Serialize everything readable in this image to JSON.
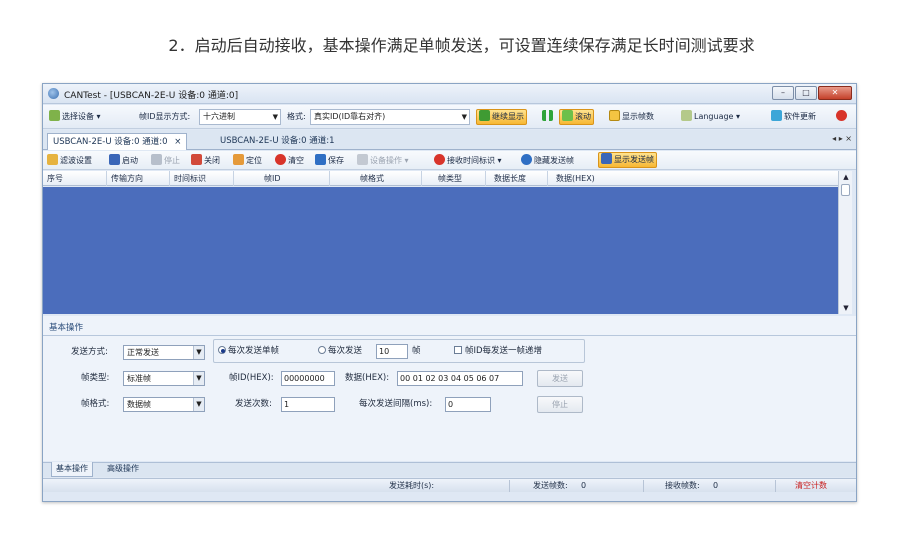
{
  "caption": "2．启动后自动接收，基本操作满足单帧发送，可设置连续保存满足长时间测试要求",
  "window": {
    "title": "CANTest - [USBCAN-2E-U 设备:0 通道:0]",
    "controls": {
      "minimize": "–",
      "maximize": "□",
      "close": "✕"
    }
  },
  "toolbar1": {
    "select_device": "选择设备",
    "frame_id_display_label": "帧ID显示方式:",
    "frame_id_display_value": "十六进制",
    "format_label": "格式:",
    "format_value": "真实ID(ID靠右对齐)",
    "continuous_display": "继续显示",
    "pause_icon_label": "",
    "scroll": "滚动",
    "show_frame_count": "显示帧数",
    "language": "Language",
    "software_update": "软件更新"
  },
  "tabs": [
    {
      "label": "USBCAN-2E-U 设备:0 通道:0",
      "close": "×"
    },
    {
      "label": "USBCAN-2E-U 设备:0 通道:1"
    }
  ],
  "tab_arrows": "◂ ▸ ×",
  "toolbar2": {
    "filter_settings": "滤波设置",
    "start": "启动",
    "stop": "停止",
    "close": "关闭",
    "locate": "定位",
    "clear": "清空",
    "save": "保存",
    "device_ops": "设备操作",
    "receive_time_mark": "接收时间标识",
    "hide_send_frame": "隐藏发送帧",
    "show_send_frame": "显示发送帧"
  },
  "grid": {
    "columns": [
      "序号",
      "传输方向",
      "时间标识",
      "帧ID",
      "帧格式",
      "帧类型",
      "数据长度",
      "数据(HEX)"
    ]
  },
  "panel": {
    "title": "基本操作",
    "send_mode_label": "发送方式:",
    "send_mode_value": "正常发送",
    "frame_type_label": "帧类型:",
    "frame_type_value": "标准帧",
    "frame_format_label": "帧格式:",
    "frame_format_value": "数据帧",
    "radio_single": "每次发送单帧",
    "radio_multi": "每次发送",
    "multi_count": "10",
    "frame_unit": "帧",
    "check_increment": "帧ID每发送一帧递增",
    "frame_id_label": "帧ID(HEX):",
    "frame_id_value": "00000000",
    "data_label": "数据(HEX):",
    "data_value": "00 01 02 03 04 05 06 07",
    "send_button": "发送",
    "send_times_label": "发送次数:",
    "send_times_value": "1",
    "interval_label": "每次发送间隔(ms):",
    "interval_value": "0",
    "stop_button": "停止"
  },
  "bottom_tabs": [
    "基本操作",
    "高级操作"
  ],
  "status": {
    "send_elapsed": "发送耗时(s):",
    "sent_frames_label": "发送帧数:",
    "sent_frames_value": "0",
    "recv_frames_label": "接收帧数:",
    "recv_frames_value": "0",
    "clear_count": "清空计数"
  },
  "colors": {
    "grid_body": "#4b6dbc",
    "highlight": "#f7b733",
    "clear_count": "#c81e1e"
  }
}
